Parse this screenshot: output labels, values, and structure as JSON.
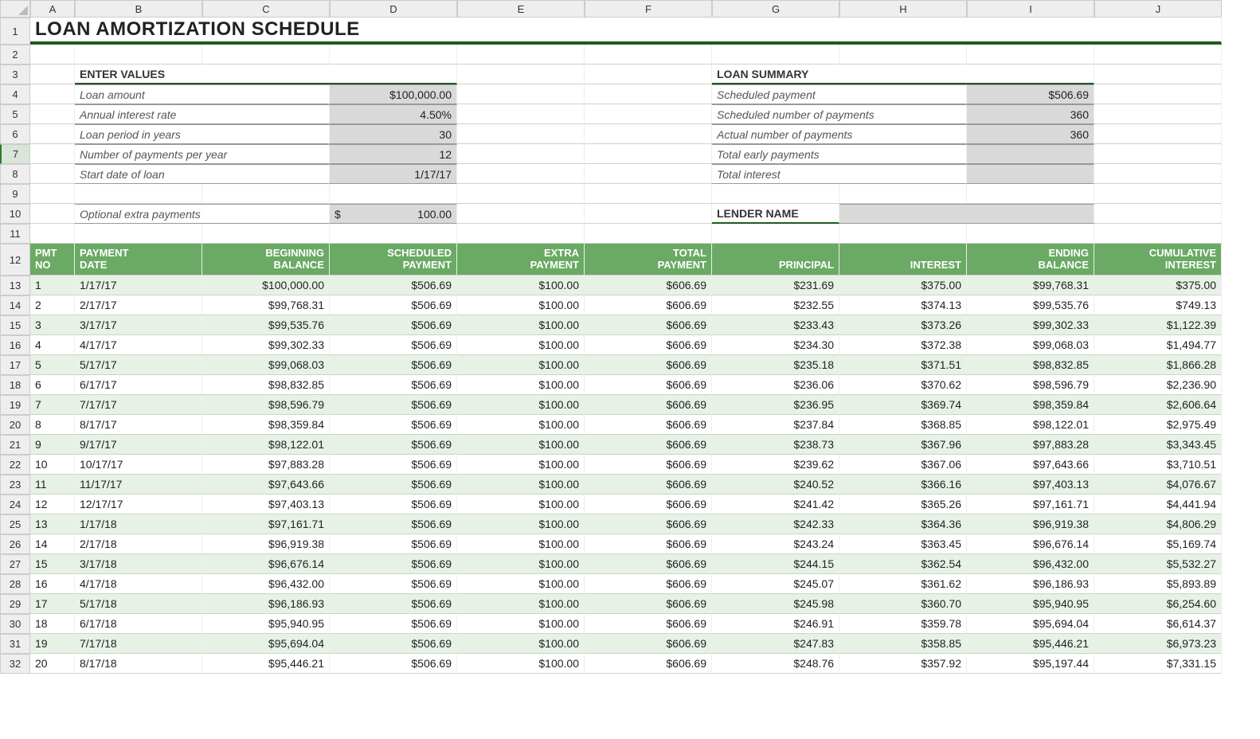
{
  "columns": [
    "A",
    "B",
    "C",
    "D",
    "E",
    "F",
    "G",
    "H",
    "I",
    "J"
  ],
  "rows": [
    "1",
    "2",
    "3",
    "4",
    "5",
    "6",
    "7",
    "8",
    "9",
    "10",
    "11",
    "12",
    "13",
    "14",
    "15",
    "16",
    "17",
    "18",
    "19",
    "20",
    "21",
    "22",
    "23",
    "24",
    "25",
    "26",
    "27",
    "28",
    "29",
    "30",
    "31",
    "32"
  ],
  "selected_row": "7",
  "title": "LOAN AMORTIZATION SCHEDULE",
  "enter_values": {
    "header": "ENTER VALUES",
    "rows": [
      {
        "label": "Loan amount",
        "value": "$100,000.00"
      },
      {
        "label": "Annual interest rate",
        "value": "4.50%"
      },
      {
        "label": "Loan period in years",
        "value": "30"
      },
      {
        "label": "Number of payments per year",
        "value": "12"
      },
      {
        "label": "Start date of loan",
        "value": "1/17/17"
      }
    ],
    "extra": {
      "label": "Optional extra payments",
      "prefix": "$",
      "value": "100.00"
    }
  },
  "loan_summary": {
    "header": "LOAN SUMMARY",
    "rows": [
      {
        "label": "Scheduled payment",
        "value": "$506.69"
      },
      {
        "label": "Scheduled number of payments",
        "value": "360"
      },
      {
        "label": "Actual number of payments",
        "value": "360"
      },
      {
        "label": "Total early payments",
        "value": ""
      },
      {
        "label": "Total interest",
        "value": ""
      }
    ],
    "lender_label": "LENDER NAME",
    "lender_value": ""
  },
  "table": {
    "headers": [
      "PMT\nNO",
      "PAYMENT\nDATE",
      "BEGINNING\nBALANCE",
      "SCHEDULED\nPAYMENT",
      "EXTRA\nPAYMENT",
      "TOTAL\nPAYMENT",
      "PRINCIPAL",
      "INTEREST",
      "ENDING\nBALANCE",
      "CUMULATIVE\nINTEREST"
    ],
    "align": [
      "left",
      "left",
      "right",
      "right",
      "right",
      "right",
      "right",
      "right",
      "right",
      "right"
    ],
    "rows": [
      [
        "1",
        "1/17/17",
        "$100,000.00",
        "$506.69",
        "$100.00",
        "$606.69",
        "$231.69",
        "$375.00",
        "$99,768.31",
        "$375.00"
      ],
      [
        "2",
        "2/17/17",
        "$99,768.31",
        "$506.69",
        "$100.00",
        "$606.69",
        "$232.55",
        "$374.13",
        "$99,535.76",
        "$749.13"
      ],
      [
        "3",
        "3/17/17",
        "$99,535.76",
        "$506.69",
        "$100.00",
        "$606.69",
        "$233.43",
        "$373.26",
        "$99,302.33",
        "$1,122.39"
      ],
      [
        "4",
        "4/17/17",
        "$99,302.33",
        "$506.69",
        "$100.00",
        "$606.69",
        "$234.30",
        "$372.38",
        "$99,068.03",
        "$1,494.77"
      ],
      [
        "5",
        "5/17/17",
        "$99,068.03",
        "$506.69",
        "$100.00",
        "$606.69",
        "$235.18",
        "$371.51",
        "$98,832.85",
        "$1,866.28"
      ],
      [
        "6",
        "6/17/17",
        "$98,832.85",
        "$506.69",
        "$100.00",
        "$606.69",
        "$236.06",
        "$370.62",
        "$98,596.79",
        "$2,236.90"
      ],
      [
        "7",
        "7/17/17",
        "$98,596.79",
        "$506.69",
        "$100.00",
        "$606.69",
        "$236.95",
        "$369.74",
        "$98,359.84",
        "$2,606.64"
      ],
      [
        "8",
        "8/17/17",
        "$98,359.84",
        "$506.69",
        "$100.00",
        "$606.69",
        "$237.84",
        "$368.85",
        "$98,122.01",
        "$2,975.49"
      ],
      [
        "9",
        "9/17/17",
        "$98,122.01",
        "$506.69",
        "$100.00",
        "$606.69",
        "$238.73",
        "$367.96",
        "$97,883.28",
        "$3,343.45"
      ],
      [
        "10",
        "10/17/17",
        "$97,883.28",
        "$506.69",
        "$100.00",
        "$606.69",
        "$239.62",
        "$367.06",
        "$97,643.66",
        "$3,710.51"
      ],
      [
        "11",
        "11/17/17",
        "$97,643.66",
        "$506.69",
        "$100.00",
        "$606.69",
        "$240.52",
        "$366.16",
        "$97,403.13",
        "$4,076.67"
      ],
      [
        "12",
        "12/17/17",
        "$97,403.13",
        "$506.69",
        "$100.00",
        "$606.69",
        "$241.42",
        "$365.26",
        "$97,161.71",
        "$4,441.94"
      ],
      [
        "13",
        "1/17/18",
        "$97,161.71",
        "$506.69",
        "$100.00",
        "$606.69",
        "$242.33",
        "$364.36",
        "$96,919.38",
        "$4,806.29"
      ],
      [
        "14",
        "2/17/18",
        "$96,919.38",
        "$506.69",
        "$100.00",
        "$606.69",
        "$243.24",
        "$363.45",
        "$96,676.14",
        "$5,169.74"
      ],
      [
        "15",
        "3/17/18",
        "$96,676.14",
        "$506.69",
        "$100.00",
        "$606.69",
        "$244.15",
        "$362.54",
        "$96,432.00",
        "$5,532.27"
      ],
      [
        "16",
        "4/17/18",
        "$96,432.00",
        "$506.69",
        "$100.00",
        "$606.69",
        "$245.07",
        "$361.62",
        "$96,186.93",
        "$5,893.89"
      ],
      [
        "17",
        "5/17/18",
        "$96,186.93",
        "$506.69",
        "$100.00",
        "$606.69",
        "$245.98",
        "$360.70",
        "$95,940.95",
        "$6,254.60"
      ],
      [
        "18",
        "6/17/18",
        "$95,940.95",
        "$506.69",
        "$100.00",
        "$606.69",
        "$246.91",
        "$359.78",
        "$95,694.04",
        "$6,614.37"
      ],
      [
        "19",
        "7/17/18",
        "$95,694.04",
        "$506.69",
        "$100.00",
        "$606.69",
        "$247.83",
        "$358.85",
        "$95,446.21",
        "$6,973.23"
      ],
      [
        "20",
        "8/17/18",
        "$95,446.21",
        "$506.69",
        "$100.00",
        "$606.69",
        "$248.76",
        "$357.92",
        "$95,197.44",
        "$7,331.15"
      ]
    ]
  }
}
